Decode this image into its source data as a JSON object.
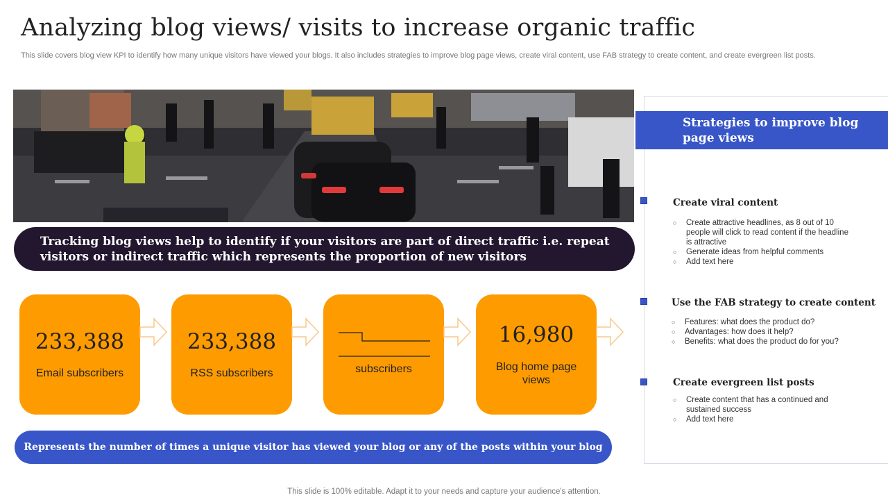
{
  "header": {
    "title": "Analyzing blog views/ visits to increase organic traffic",
    "subtitle": "This slide covers blog view KPI to identify how many unique visitors have viewed your blogs. It also includes strategies to improve blog page views, create viral content, use FAB strategy to create content, and create evergreen list posts."
  },
  "banner": {
    "text": "Tracking blog views help to identify if your visitors are part of direct traffic i.e. repeat visitors or indirect traffic which represents the proportion of new visitors"
  },
  "kpis": [
    {
      "value": "233,388",
      "label": "Email subscribers"
    },
    {
      "value": "233,388",
      "label": "RSS subscribers"
    },
    {
      "value": "",
      "label": "subscribers"
    },
    {
      "value": "16,980",
      "label": "Blog home page views"
    }
  ],
  "note": {
    "text": "Represents the number of times a unique visitor has viewed your blog or any of the posts within your blog"
  },
  "strategies": {
    "heading": "Strategies to improve blog page views",
    "sections": [
      {
        "title": "Create viral content",
        "bullets": [
          "Create attractive headlines, as 8 out of 10 people will click to read content if the headline is attractive",
          "Generate ideas from helpful comments",
          "Add text here"
        ]
      },
      {
        "title": "Use the FAB strategy to create content",
        "bullets": [
          "Features: what does the product do?",
          "Advantages: how does it help?",
          "Benefits: what does the product do for you?"
        ]
      },
      {
        "title": "Create evergreen list posts",
        "bullets": [
          "Create content that has a continued and sustained success",
          "Add text here"
        ]
      }
    ]
  },
  "footer": {
    "text": "This slide is 100% editable. Adapt it to your needs and capture your audience's attention."
  },
  "colors": {
    "accent_blue": "#3856c8",
    "kpi_orange": "#fe9b00",
    "banner_dark": "#22172f"
  }
}
